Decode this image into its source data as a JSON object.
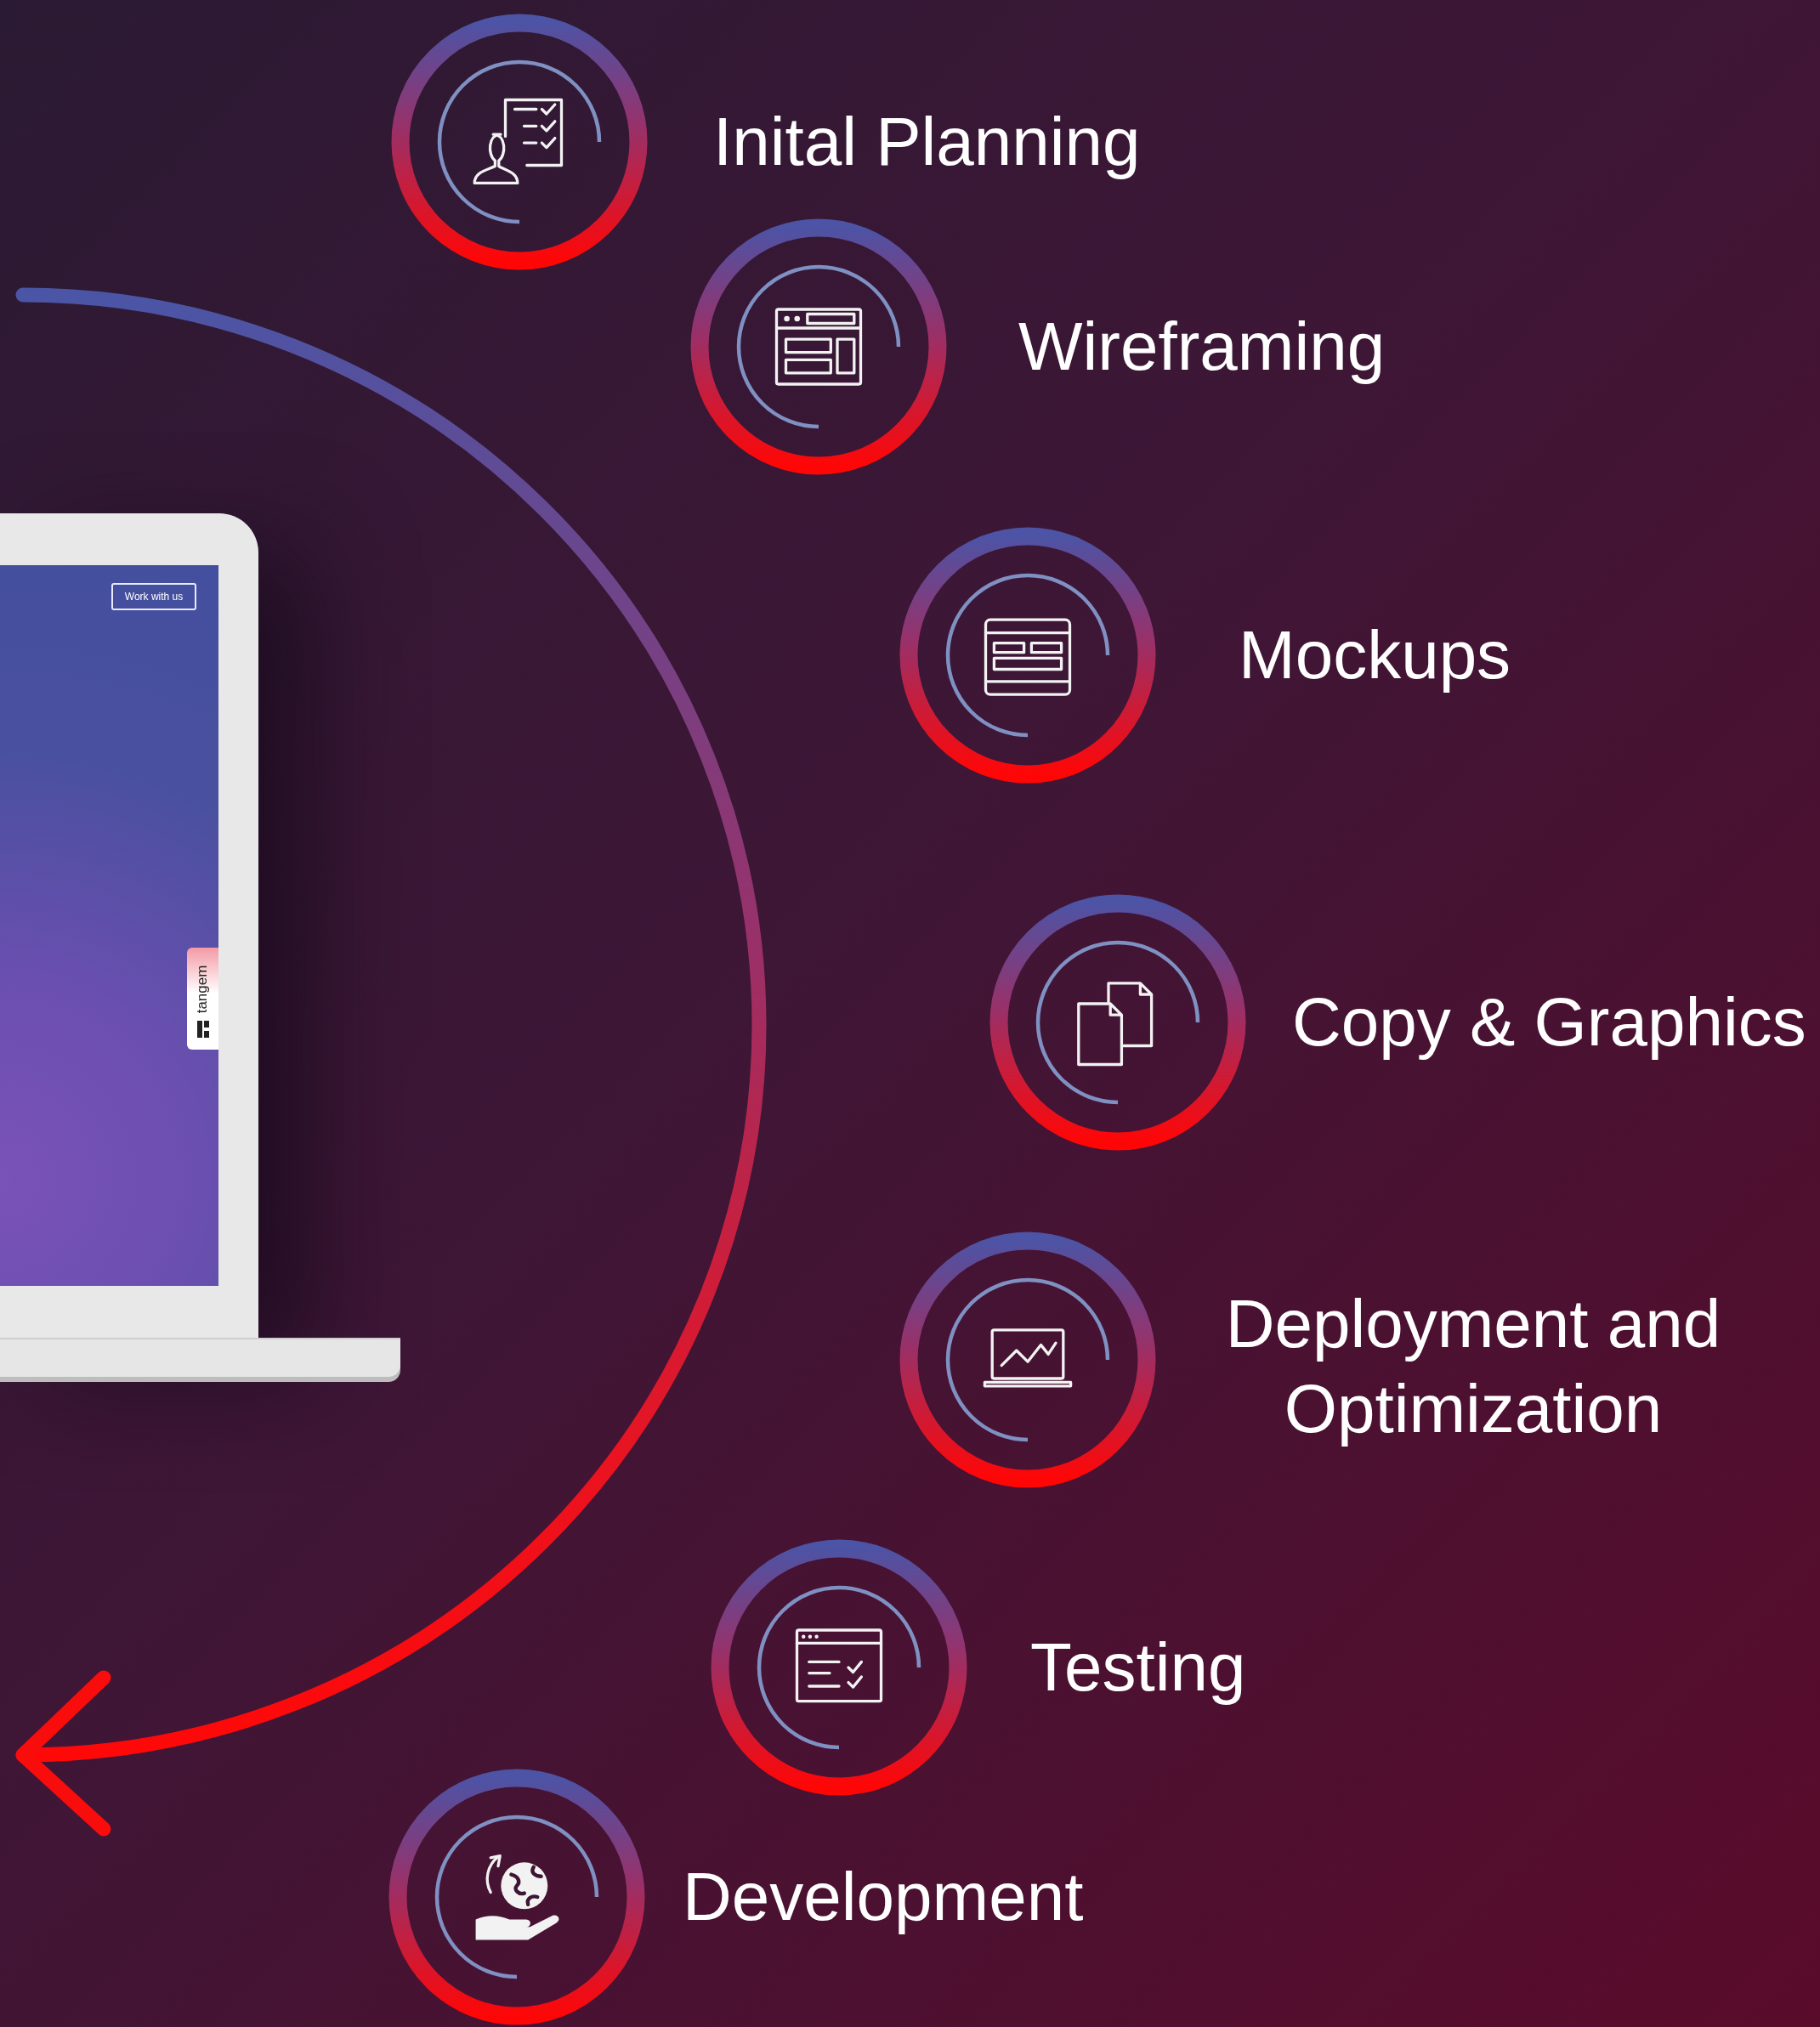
{
  "laptop": {
    "screen_button": "Work with us",
    "side_tab": "tangem"
  },
  "steps": [
    {
      "label": "Inital Planning"
    },
    {
      "label": "Wireframing"
    },
    {
      "label": "Mockups"
    },
    {
      "label": "Copy & Graphics"
    },
    {
      "label": "Deployment and Optimization"
    },
    {
      "label": "Testing"
    },
    {
      "label": "Development"
    }
  ]
}
